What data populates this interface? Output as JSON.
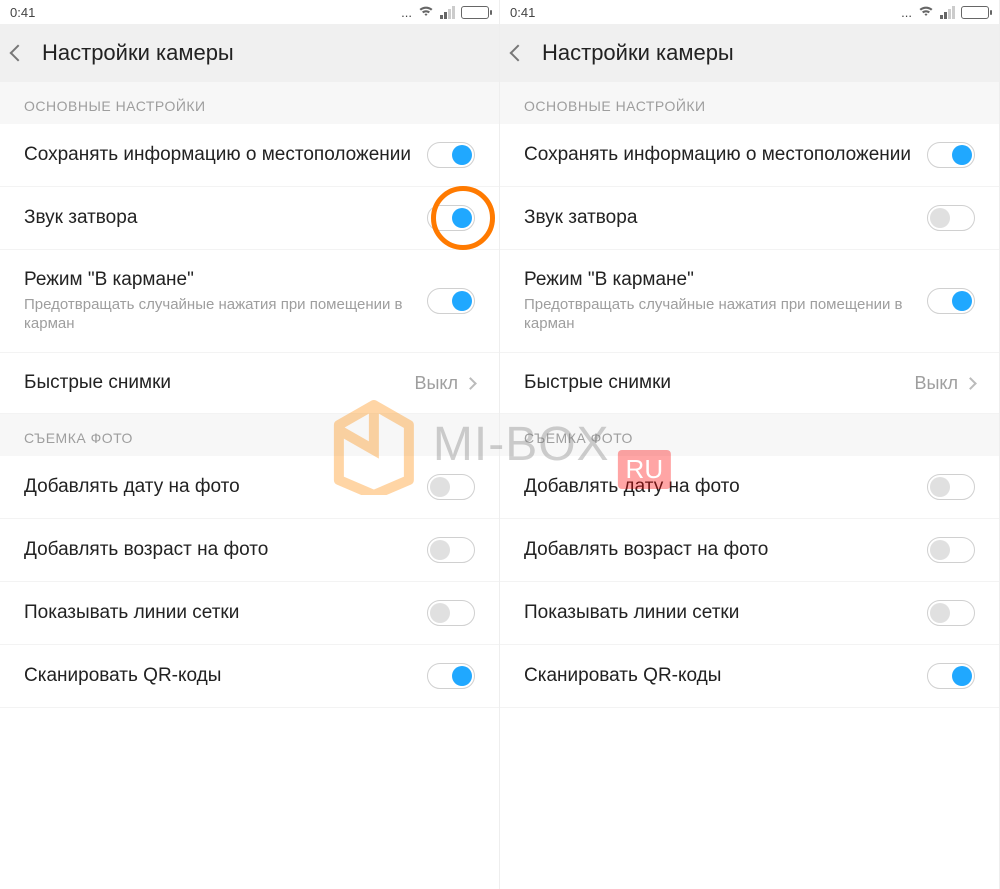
{
  "statusbar": {
    "time": "0:41",
    "dots": "..."
  },
  "header": {
    "title": "Настройки камеры"
  },
  "sections": {
    "main_header": "ОСНОВНЫЕ НАСТРОЙКИ",
    "photo_header": "СЪЕМКА ФОТО"
  },
  "rows": {
    "location": {
      "label": "Сохранять информацию о местоположении"
    },
    "shutter": {
      "label": "Звук затвора"
    },
    "pocket": {
      "label": "Режим \"В кармане\"",
      "sub": "Предотвращать случайные нажатия при помещении в карман"
    },
    "quick": {
      "label": "Быстрые снимки",
      "value": "Выкл"
    },
    "date": {
      "label": "Добавлять дату на фото"
    },
    "age": {
      "label": "Добавлять возраст на фото"
    },
    "grid": {
      "label": "Показывать линии сетки"
    },
    "qr": {
      "label": "Сканировать QR-коды"
    }
  },
  "watermark": {
    "text": "MI-BOX",
    "suffix": "RU"
  },
  "panels": {
    "left": {
      "shutter_on": true,
      "highlight_shutter": true
    },
    "right": {
      "shutter_on": false,
      "highlight_shutter": false
    }
  }
}
